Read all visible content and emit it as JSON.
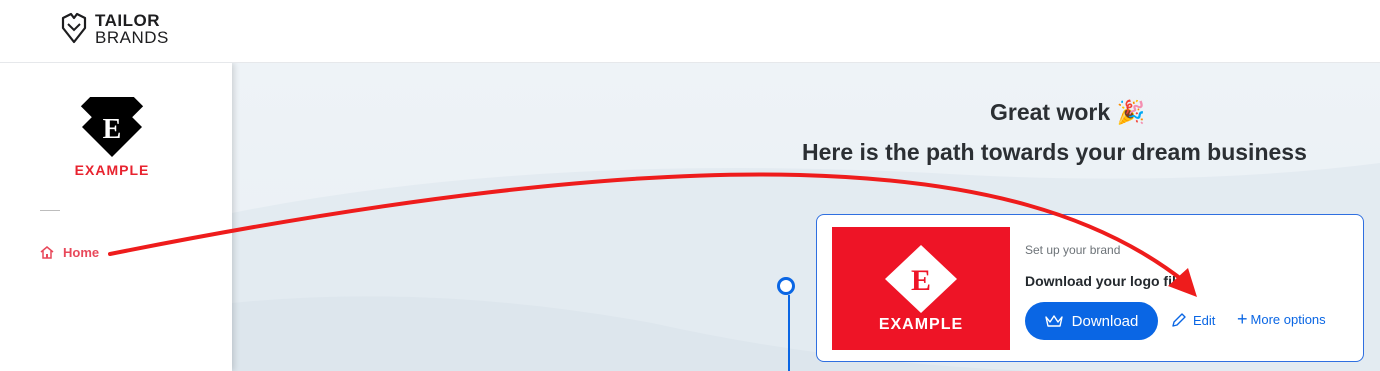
{
  "brand": {
    "line1": "TAILOR",
    "line2": "BRANDS",
    "icon": "diamond-shield-icon"
  },
  "sidebar": {
    "logo_letter": "E",
    "logo_text": "EXAMPLE",
    "nav": [
      {
        "label": "Home",
        "icon": "home-icon",
        "active": true
      }
    ]
  },
  "main": {
    "headline": "Great work 🎉",
    "subheadline": "Here is the path towards your dream business",
    "card": {
      "subtitle": "Set up your brand",
      "title": "Download your logo files",
      "thumb_letter": "E",
      "thumb_text": "EXAMPLE",
      "download_label": "Download",
      "download_icon": "crown-icon",
      "edit_label": "Edit",
      "edit_icon": "pencil-icon",
      "more_label": "More options",
      "more_icon": "plus-icon"
    }
  },
  "colors": {
    "brand_red": "#e8232f",
    "accent_blue": "#0a66e4",
    "annotation_arrow": "#ee1c1c"
  }
}
